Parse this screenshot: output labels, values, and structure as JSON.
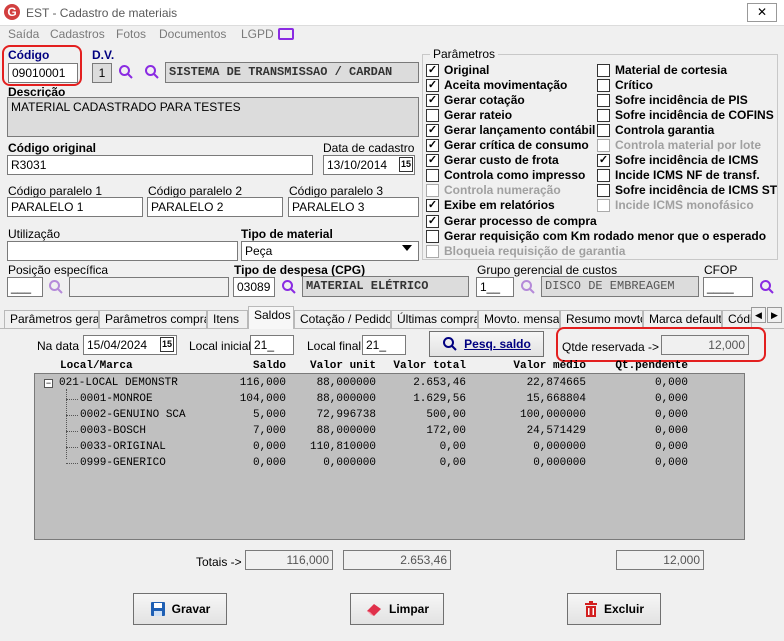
{
  "window": {
    "title": "EST - Cadastro de materiais",
    "logo": "G",
    "close": "✕"
  },
  "menu": [
    "Saída",
    "Cadastros",
    "Fotos",
    "Documentos",
    "LGPD"
  ],
  "codigo": {
    "label": "Código",
    "value": "09010001"
  },
  "dv": {
    "label": "D.V.",
    "value": "1"
  },
  "subgrupo": {
    "value": "SISTEMA DE TRANSMISSAO / CARDAN"
  },
  "descricao": {
    "label": "Descrição",
    "value": "MATERIAL CADASTRADO PARA TESTES"
  },
  "codigo_original": {
    "label": "Código original",
    "value": "R3031"
  },
  "data_cadastro": {
    "label": "Data de cadastro",
    "value": "13/10/2014",
    "cal": "15"
  },
  "paralelos": [
    {
      "label": "Código paralelo 1",
      "value": "PARALELO 1"
    },
    {
      "label": "Código paralelo 2",
      "value": "PARALELO 2"
    },
    {
      "label": "Código paralelo 3",
      "value": "PARALELO 3"
    }
  ],
  "utilizacao": {
    "label": "Utilização",
    "value": ""
  },
  "tipo_material": {
    "label": "Tipo de material",
    "value": "Peça"
  },
  "posicao": {
    "label": "Posição específica",
    "value": "___"
  },
  "tipo_despesa": {
    "label": "Tipo de despesa (CPG)",
    "code": "03089",
    "value": "MATERIAL ELÉTRICO"
  },
  "grupo_gerencial": {
    "label": "Grupo gerencial de custos",
    "code": "1__",
    "value": "DISCO DE EMBREAGEM"
  },
  "cfop": {
    "label": "CFOP",
    "value": "____"
  },
  "parametros": {
    "label": "Parâmetros",
    "left": [
      {
        "label": "Original",
        "checked": true,
        "enabled": true
      },
      {
        "label": "Aceita movimentação",
        "checked": true,
        "enabled": true
      },
      {
        "label": "Gerar cotação",
        "checked": true,
        "enabled": true
      },
      {
        "label": "Gerar rateio",
        "checked": false,
        "enabled": true
      },
      {
        "label": "Gerar lançamento contábil",
        "checked": true,
        "enabled": true
      },
      {
        "label": "Gerar crítica de consumo",
        "checked": true,
        "enabled": true
      },
      {
        "label": "Gerar custo de frota",
        "checked": true,
        "enabled": true
      },
      {
        "label": "Controla como impresso",
        "checked": false,
        "enabled": true
      },
      {
        "label": "Controla numeração",
        "checked": false,
        "enabled": false
      },
      {
        "label": "Exibe em relatórios",
        "checked": true,
        "enabled": true
      }
    ],
    "right": [
      {
        "label": "Material de cortesia",
        "checked": false,
        "enabled": true
      },
      {
        "label": "Crítico",
        "checked": false,
        "enabled": true
      },
      {
        "label": "Sofre incidência de PIS",
        "checked": false,
        "enabled": true
      },
      {
        "label": "Sofre incidência de COFINS",
        "checked": false,
        "enabled": true
      },
      {
        "label": "Controla garantia",
        "checked": false,
        "enabled": true
      },
      {
        "label": "Controla material por lote",
        "checked": false,
        "enabled": false
      },
      {
        "label": "Sofre incidência de ICMS",
        "checked": true,
        "enabled": true
      },
      {
        "label": "Incide ICMS NF de transf.",
        "checked": false,
        "enabled": true
      },
      {
        "label": "Sofre incidência de ICMS ST",
        "checked": false,
        "enabled": true
      },
      {
        "label": "Incide ICMS monofásico",
        "checked": false,
        "enabled": false
      }
    ],
    "bottom": [
      {
        "label": "Gerar processo de compra",
        "checked": true,
        "enabled": true
      },
      {
        "label": "Gerar requisição com Km rodado menor que o esperado",
        "checked": false,
        "enabled": true
      },
      {
        "label": "Bloqueia requisição de garantia",
        "checked": false,
        "enabled": false
      }
    ]
  },
  "tabs": [
    "Parâmetros gerais",
    "Parâmetros compras",
    "Itens",
    "Saldos",
    "Cotação / Pedido",
    "Últimas compras",
    "Movto. mensal",
    "Resumo movto.",
    "Marca default",
    "Códi"
  ],
  "active_tab": "Saldos",
  "saldos": {
    "na_data_label": "Na data",
    "na_data": "15/04/2024",
    "cal": "15",
    "local_inicial_label": "Local inicial",
    "local_inicial": "21_",
    "local_final_label": "Local final",
    "local_final": "21_",
    "pesq_label": "Pesq. saldo",
    "qtde_reservada_label": "Qtde reservada ->",
    "qtde_reservada": "12,000",
    "columns": [
      "Local/Marca",
      "Saldo",
      "Valor unit",
      "Valor total",
      "Valor médio",
      "Qt.pendente"
    ],
    "rows": [
      {
        "name": "021-LOCAL DEMONSTR",
        "saldo": "116,000",
        "unit": "88,000000",
        "total": "2.653,46",
        "medio": "22,874665",
        "pend": "0,000"
      },
      {
        "name": "0001-MONROE",
        "saldo": "104,000",
        "unit": "88,000000",
        "total": "1.629,56",
        "medio": "15,668804",
        "pend": "0,000"
      },
      {
        "name": "0002-GENUINO SCA",
        "saldo": "5,000",
        "unit": "72,996738",
        "total": "500,00",
        "medio": "100,000000",
        "pend": "0,000"
      },
      {
        "name": "0003-BOSCH",
        "saldo": "7,000",
        "unit": "88,000000",
        "total": "172,00",
        "medio": "24,571429",
        "pend": "0,000"
      },
      {
        "name": "0033-ORIGINAL",
        "saldo": "0,000",
        "unit": "110,810000",
        "total": "0,00",
        "medio": "0,000000",
        "pend": "0,000"
      },
      {
        "name": "0999-GENERICO",
        "saldo": "0,000",
        "unit": "0,000000",
        "total": "0,00",
        "medio": "0,000000",
        "pend": "0,000"
      }
    ],
    "totais_label": "Totais ->",
    "total_saldo": "116,000",
    "total_valor": "2.653,46",
    "total_pend": "12,000"
  },
  "buttons": {
    "gravar": "Gravar",
    "limpar": "Limpar",
    "excluir": "Excluir"
  }
}
